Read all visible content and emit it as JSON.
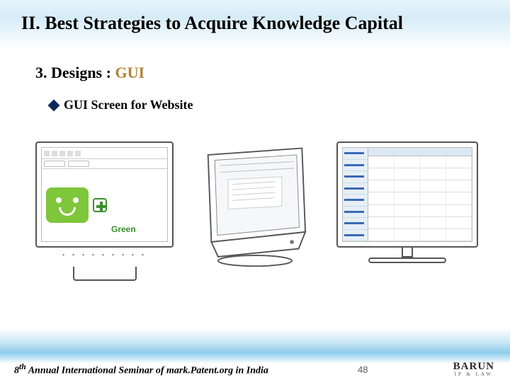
{
  "title": "II. Best Strategies to  Acquire Knowledge Capital",
  "subtitle_prefix": "3. Designs : ",
  "subtitle_accent": "GUI",
  "bullet": "GUI Screen for Website",
  "figures": {
    "fig1_label": "Green"
  },
  "footer": {
    "seminar": "8th Annual International Seminar of mark.Patent.org in India",
    "sup": "th",
    "page": "48",
    "brand_name": "BARUN",
    "brand_sub": "IP & LAW"
  }
}
